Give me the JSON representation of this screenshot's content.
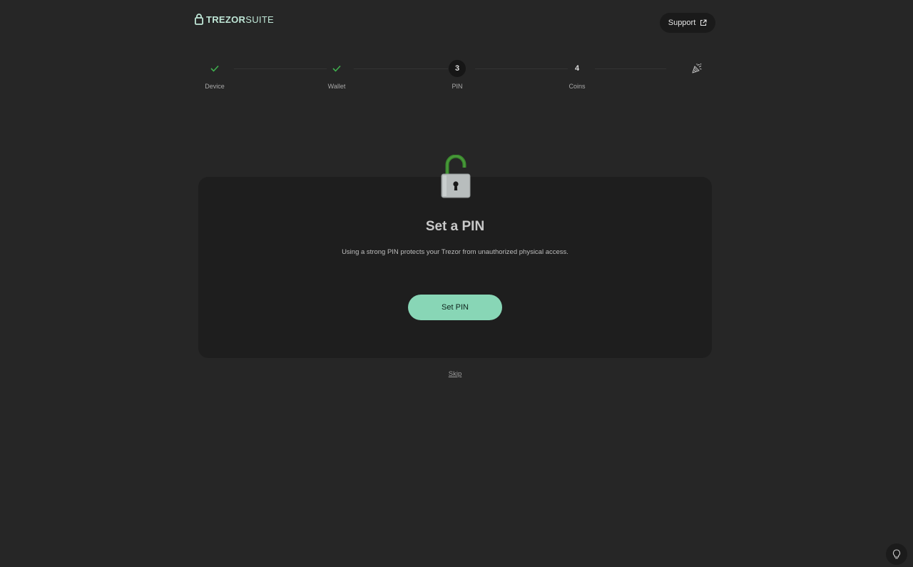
{
  "header": {
    "logo_brand": "TREZOR",
    "logo_product": "SUITE",
    "support_label": "Support"
  },
  "stepper": {
    "steps": [
      {
        "label": "Device",
        "marker": "check-icon",
        "state": "done"
      },
      {
        "label": "Wallet",
        "marker": "check-icon",
        "state": "done"
      },
      {
        "label": "PIN",
        "marker": "3",
        "state": "active"
      },
      {
        "label": "Coins",
        "marker": "4",
        "state": "pending"
      },
      {
        "label": "",
        "marker": "party-popper-icon",
        "state": "pending"
      }
    ]
  },
  "card": {
    "illustration": "lock-icon",
    "title": "Set a PIN",
    "description": "Using a strong PIN protects your Trezor from unauthorized physical access.",
    "primary_button": "Set PIN"
  },
  "skip_label": "Skip",
  "colors": {
    "background": "#262626",
    "card": "#1e1e1e",
    "accent": "#88d6b6",
    "check": "#3fae4e",
    "lock_shackle": "#3b8a2e",
    "lock_body": "#b8bdbd"
  }
}
